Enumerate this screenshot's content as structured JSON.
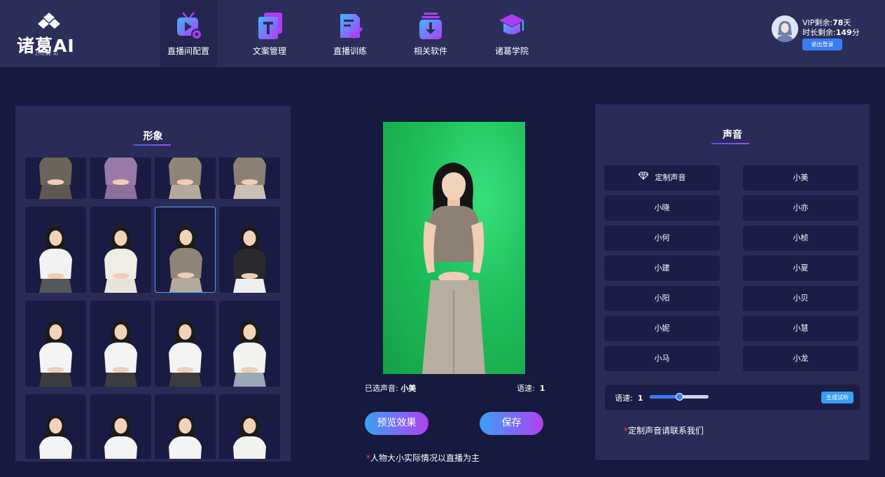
{
  "header": {
    "logo_text": "诸葛AI",
    "logo_sub": "ZHUGE AI",
    "nav": [
      {
        "label": "直播间配置",
        "active": true
      },
      {
        "label": "文案管理",
        "active": false
      },
      {
        "label": "直播训练",
        "active": false
      },
      {
        "label": "相关软件",
        "active": false
      },
      {
        "label": "诸葛学院",
        "active": false
      }
    ],
    "user": {
      "vip_prefix": "VIP剩余:",
      "vip_value": "78",
      "vip_unit": "天",
      "time_prefix": "时长剩余:",
      "time_value": "149",
      "time_unit": "分",
      "logout_label": "退出登录"
    }
  },
  "avatar_panel": {
    "title": "形象",
    "selected_index": 6,
    "items": [
      {
        "top": "#6b6458",
        "bottom": "#5e5a52",
        "hair": "#2a2320"
      },
      {
        "top": "#9a7aa8",
        "bottom": "#8c6f9a",
        "hair": "#2a2320"
      },
      {
        "top": "#8f8577",
        "bottom": "#b3aa9c",
        "hair": "#1d1a18"
      },
      {
        "top": "#8b8073",
        "bottom": "#c9bfb2",
        "hair": "#1d1a18"
      },
      {
        "top": "#f2f2f2",
        "bottom": "#55575a",
        "hair": "#1d1a18"
      },
      {
        "top": "#f0ede6",
        "bottom": "#e8e4dc",
        "hair": "#1d1a18"
      },
      {
        "top": "#8f8577",
        "bottom": "#b3aa9c",
        "hair": "#1d1a18"
      },
      {
        "top": "#2a2a2e",
        "bottom": "#eeeeee",
        "hair": "#1d1a18"
      },
      {
        "top": "#f4f4f4",
        "bottom": "#3a3c40",
        "hair": "#1d1a18"
      },
      {
        "top": "#f4f4f4",
        "bottom": "#3a3c40",
        "hair": "#1d1a18"
      },
      {
        "top": "#f4f4f4",
        "bottom": "#3a3c40",
        "hair": "#1d1a18"
      },
      {
        "top": "#f2f2f0",
        "bottom": "#9aa8b8",
        "hair": "#1d1a18"
      },
      {
        "top": "#f4f4f4",
        "bottom": "#3a3c40",
        "hair": "#1d1a18"
      },
      {
        "top": "#f4f4f4",
        "bottom": "#3a3c40",
        "hair": "#1d1a18"
      },
      {
        "top": "#f4f4f4",
        "bottom": "#3a3c40",
        "hair": "#1d1a18"
      },
      {
        "top": "#f2f2f0",
        "bottom": "#9aa8b8",
        "hair": "#1d1a18"
      }
    ]
  },
  "preview": {
    "selected_voice_label": "已选声音:",
    "selected_voice": "小美",
    "speed_label": "语速:",
    "speed_value": "1",
    "preview_button": "预览效果",
    "save_button": "保存",
    "note": "人物大小实际情况以直播为主"
  },
  "voice_panel": {
    "title": "声音",
    "voices": [
      "定制声音",
      "小美",
      "小晓",
      "小亦",
      "小何",
      "小桢",
      "小建",
      "小夏",
      "小阳",
      "小贝",
      "小妮",
      "小慧",
      "小马",
      "小龙"
    ],
    "speed_label": "语速:",
    "speed_value": "1",
    "speed_fraction": 0.5,
    "generate_button": "生成试听",
    "note": "定制声音请联系我们"
  },
  "colors": {
    "background": "#161a3e",
    "header": "#2c2e5a",
    "panel": "#2a2b57",
    "accent_blue": "#3a7cf0",
    "accent_purple": "#b040f0",
    "green_screen": "#1fbf5a"
  }
}
